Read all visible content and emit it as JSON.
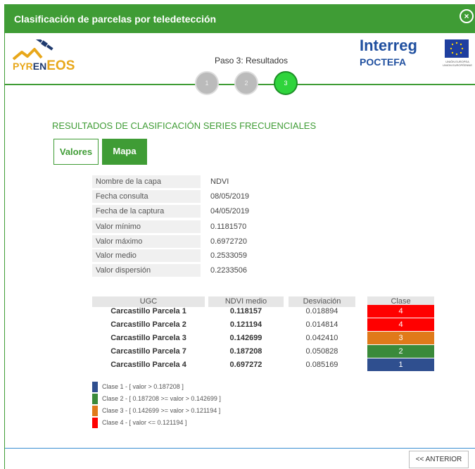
{
  "dialog": {
    "title": "Clasificación de parcelas por teledetección",
    "close_glyph": "×"
  },
  "logos": {
    "pyreneos_py": "PYR",
    "pyreneos_en": "EN",
    "pyreneos_eos": "EOS",
    "interreg": "Interreg",
    "poctefa": "POCTEFA",
    "eu_line1": "UNIÓN EUROPEA",
    "eu_line2": "UNION EUROPÉENNE"
  },
  "wizard": {
    "step_label": "Paso 3: Resultados",
    "steps": [
      "1",
      "2",
      "3"
    ],
    "active_step": 3
  },
  "section_title": "RESULTADOS DE CLASIFICACIÓN SERIES FRECUENCIALES",
  "tabs": {
    "valores": "Valores",
    "mapa": "Mapa"
  },
  "info": [
    {
      "label": "Nombre de la capa",
      "value": "NDVI"
    },
    {
      "label": "Fecha consulta",
      "value": "08/05/2019"
    },
    {
      "label": "Fecha de la captura",
      "value": "04/05/2019"
    },
    {
      "label": "Valor mínimo",
      "value": "0.1181570"
    },
    {
      "label": "Valor máximo",
      "value": "0.6972720"
    },
    {
      "label": "Valor medio",
      "value": "0.2533059"
    },
    {
      "label": "Valor dispersión",
      "value": "0.2233506"
    }
  ],
  "table": {
    "headers": [
      "UGC",
      "NDVI medio",
      "Desviación",
      "Clase"
    ],
    "rows": [
      {
        "ugc": "Carcastillo Parcela 1",
        "ndvi": "0.118157",
        "desviacion": "0.018894",
        "clase": "4",
        "color": "#ff0000"
      },
      {
        "ugc": "Carcastillo Parcela 2",
        "ndvi": "0.121194",
        "desviacion": "0.014814",
        "clase": "4",
        "color": "#ff0000"
      },
      {
        "ugc": "Carcastillo Parcela 3",
        "ndvi": "0.142699",
        "desviacion": "0.042410",
        "clase": "3",
        "color": "#e07a1a"
      },
      {
        "ugc": "Carcastillo Parcela 7",
        "ndvi": "0.187208",
        "desviacion": "0.050828",
        "clase": "2",
        "color": "#3a8a3a"
      },
      {
        "ugc": "Carcastillo Parcela 4",
        "ndvi": "0.697272",
        "desviacion": "0.085169",
        "clase": "1",
        "color": "#2f4f8f"
      }
    ]
  },
  "legend": [
    {
      "text": "Clase 1 - [ valor > 0.187208 ]",
      "color": "#2f4f8f"
    },
    {
      "text": "Clase 2 - [ 0.187208 >= valor > 0.142699 ]",
      "color": "#3a8a3a"
    },
    {
      "text": "Clase 3 - [ 0.142699 >= valor > 0.121194 ]",
      "color": "#e07a1a"
    },
    {
      "text": "Clase 4 - [ valor <= 0.121194 ]",
      "color": "#ff0000"
    }
  ],
  "footer": {
    "anterior_label": "<< ANTERIOR"
  },
  "colors": {
    "brand_green": "#3f9c35",
    "step_active": "#2fd43c",
    "footer_line": "#3a8fd1"
  }
}
